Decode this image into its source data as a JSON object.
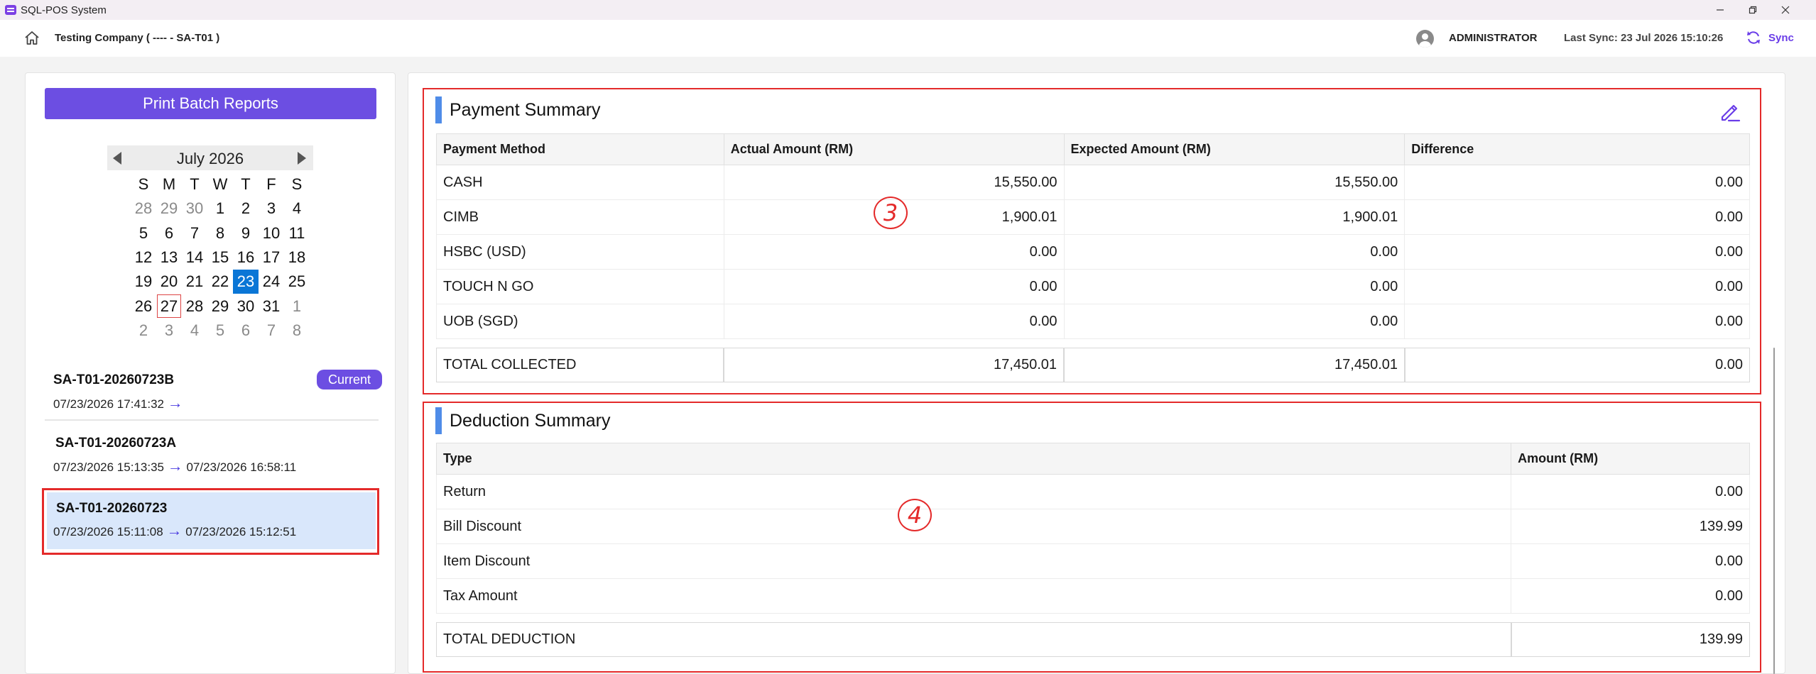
{
  "window": {
    "title": "SQL-POS System",
    "icons": {
      "app": "app-logo-icon",
      "minimize": "minimize-icon",
      "maximize": "restore-icon",
      "close": "close-icon"
    }
  },
  "header": {
    "company": "Testing Company ( ---- - SA-T01 )",
    "user": "ADMINISTRATOR",
    "last_sync": "Last Sync: 23 Jul 2026 15:10:26",
    "sync_label": "Sync",
    "colors": {
      "accent": "#6a3de8"
    }
  },
  "left": {
    "print_button": "Print Batch Reports",
    "calendar": {
      "month_label": "July 2026",
      "weekdays": [
        "S",
        "M",
        "T",
        "W",
        "T",
        "F",
        "S"
      ],
      "weeks": [
        [
          "28",
          "29",
          "30",
          "1",
          "2",
          "3",
          "4"
        ],
        [
          "5",
          "6",
          "7",
          "8",
          "9",
          "10",
          "11"
        ],
        [
          "12",
          "13",
          "14",
          "15",
          "16",
          "17",
          "18"
        ],
        [
          "19",
          "20",
          "21",
          "22",
          "23",
          "24",
          "25"
        ],
        [
          "26",
          "27",
          "28",
          "29",
          "30",
          "31",
          "1"
        ],
        [
          "2",
          "3",
          "4",
          "5",
          "6",
          "7",
          "8"
        ]
      ],
      "selected_day": "23",
      "today_day": "27"
    },
    "batches": [
      {
        "id": "SA-T01-20260723B",
        "start": "07/23/2026 17:41:32",
        "arrow": "→",
        "end": "",
        "badge": "Current"
      },
      {
        "id": "SA-T01-20260723A",
        "start": "07/23/2026 15:13:35",
        "arrow": "→",
        "end": "07/23/2026 16:58:11",
        "badge": ""
      },
      {
        "id": "SA-T01-20260723",
        "start": "07/23/2026 15:11:08",
        "arrow": "→",
        "end": "07/23/2026 15:12:51",
        "badge": ""
      }
    ]
  },
  "payment": {
    "title": "Payment Summary",
    "annotation": "3",
    "headers": [
      "Payment Method",
      "Actual Amount (RM)",
      "Expected Amount (RM)",
      "Difference"
    ],
    "rows": [
      [
        "CASH",
        "15,550.00",
        "15,550.00",
        "0.00"
      ],
      [
        "CIMB",
        "1,900.01",
        "1,900.01",
        "0.00"
      ],
      [
        "HSBC (USD)",
        "0.00",
        "0.00",
        "0.00"
      ],
      [
        "TOUCH N GO",
        "0.00",
        "0.00",
        "0.00"
      ],
      [
        "UOB (SGD)",
        "0.00",
        "0.00",
        "0.00"
      ]
    ],
    "total": [
      "TOTAL COLLECTED",
      "17,450.01",
      "17,450.01",
      "0.00"
    ]
  },
  "deduction": {
    "title": "Deduction Summary",
    "annotation": "4",
    "headers": [
      "Type",
      "Amount (RM)"
    ],
    "rows": [
      [
        "Return",
        "0.00"
      ],
      [
        "Bill Discount",
        "139.99"
      ],
      [
        "Item Discount",
        "0.00"
      ],
      [
        "Tax Amount",
        "0.00"
      ]
    ],
    "total": [
      "TOTAL DEDUCTION",
      "139.99"
    ]
  }
}
